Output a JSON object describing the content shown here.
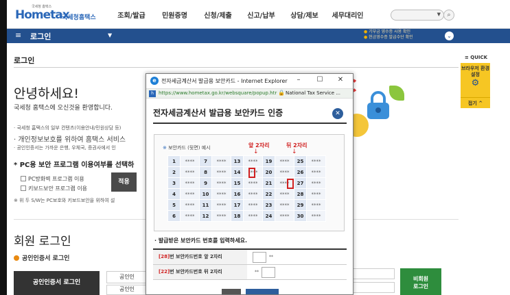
{
  "header": {
    "logo_main": "Hometax",
    "logo_small": "국세청 홈택스",
    "logo_kr": "국세청홈택스",
    "gnb": [
      "조회/발급",
      "민원증명",
      "신청/제출",
      "신고/납부",
      "상담/제보",
      "세무대리인"
    ],
    "search_icon": "search-icon"
  },
  "bluebar": {
    "menu_label": "로그인",
    "notices": [
      "기부금 영수증 사용 확인",
      "현금영수증 발급수단 확인"
    ]
  },
  "main": {
    "page_title": "로그인",
    "hello": "안녕하세요!",
    "welcome": "국세청 홈택스에 오신것을 환영합니다.",
    "bullets": [
      "국세청 홈택스의 일부 컨텐츠(이용안내/민원상담 등)",
      "개인정보보호를 위하여 홈택스 서비스",
      "공인인증서는 가까운 은행, 우체국, 증권사에서 인"
    ],
    "pc_title": "* PC용 보안 프로그램 이용여부를 선택하",
    "checks": [
      "PC방화벽 프로그램 이용",
      "키보드보안 프로그램 이용"
    ],
    "apply_label": "적용",
    "foot_note": "※ 위 두 S/W는 PC보호와 키보드보안을 위하여 설",
    "member_title": "회원 로그인",
    "cert_link": "공인인증서 로그인",
    "cert_login_btn": "공인인증서 로그인",
    "tab_a": "공인인",
    "tab_b": "공인인",
    "guest_btn_line1": "비회원",
    "guest_btn_line2": "로그인"
  },
  "quick": {
    "label": "≡ QUICK",
    "card_label": "브라우저 환경설정",
    "card_icon": "gear-icon",
    "close_label": "접기 ^"
  },
  "popup": {
    "window_title": "전자세금계산서 발급용 보안카드 - Internet Explorer",
    "url": "https://www.hometax.go.kr/websquare/popup.htr",
    "org": "National Tax Service ...",
    "heading": "전자세금계산서 발급용 보안카드 인증",
    "card_caption": "보안카드 (뒷면) 예시",
    "pos_front": "앞 2자리",
    "pos_back": "뒤 2자리",
    "mask": "****",
    "grid": [
      [
        1,
        7,
        13,
        19,
        25
      ],
      [
        2,
        8,
        14,
        20,
        26
      ],
      [
        3,
        9,
        15,
        21,
        27
      ],
      [
        4,
        10,
        16,
        22,
        28
      ],
      [
        5,
        11,
        17,
        23,
        29
      ],
      [
        6,
        12,
        18,
        24,
        30
      ]
    ],
    "enter_title": "· 발급받은 보안카드 번호를 입력하세요.",
    "row1_num": "[28]",
    "row1_text": "번 보안카드번호 앞 2자리",
    "row1_mask": "**",
    "row2_num": "[22]",
    "row2_text": "번 보안카드번호 뒤 2자리",
    "row2_mask": "**"
  }
}
